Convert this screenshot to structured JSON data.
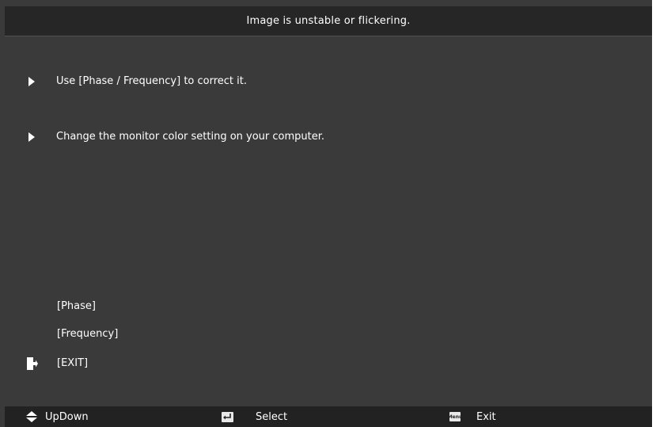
{
  "title": "Image is unstable or flickering.",
  "tips": [
    "Use [Phase / Frequency] to correct it.",
    "Change the monitor color setting on your computer."
  ],
  "menu": {
    "phase": "[Phase]",
    "frequency": "[Frequency]",
    "exit": "[EXIT]"
  },
  "footer": {
    "updown": "UpDown",
    "select": "Select",
    "menu_glyph": "Menu",
    "exit": "Exit"
  },
  "colors": {
    "background": "#3a3a3a",
    "titlebar": "#262626",
    "footer": "#222222",
    "text": "#ffffff"
  },
  "icons": {
    "bullet": "triangle-right-icon",
    "exit": "exit-door-icon",
    "updown": "up-down-arrows-icon",
    "select": "enter-key-icon",
    "menu": "menu-key-icon"
  }
}
